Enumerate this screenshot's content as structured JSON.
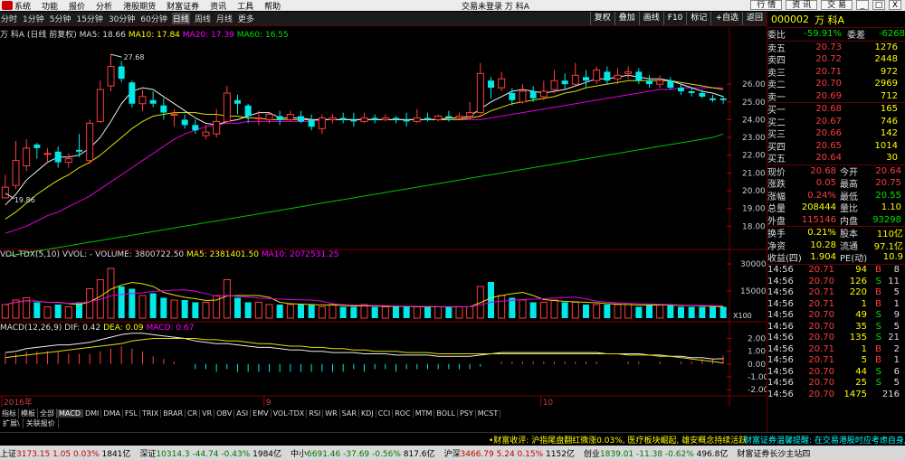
{
  "menu": {
    "items": [
      "系统",
      "功能",
      "报价",
      "分析",
      "港股期货",
      "财富证券",
      "资讯",
      "工具",
      "帮助"
    ],
    "title": "交易未登录  万 科A",
    "right_buttons": [
      "行 情",
      "资 讯",
      "交 易"
    ],
    "window_buttons": [
      "_",
      "□",
      "X"
    ]
  },
  "periods": {
    "items": [
      "分时",
      "1分钟",
      "5分钟",
      "15分钟",
      "30分钟",
      "60分钟",
      "日线",
      "周线",
      "月线",
      "更多"
    ],
    "active": "日线",
    "tools": [
      "复权",
      "叠加",
      "画线",
      "F10",
      "标记",
      "+自选",
      "返回"
    ]
  },
  "legend_main": {
    "name": "万 科A",
    "mode": "(日线 前复权)",
    "ma5_label": "MA5: 18.66",
    "ma10_label": "MA10: 17.84",
    "ma20_label": "MA20: 17.39",
    "ma60_label": "MA60: 16.55"
  },
  "legend_vol": {
    "name": "VOL-TDX(5,10)",
    "vvol": "VVOL: -",
    "volume": "VOLUME: 3800722.50",
    "ma5": "MA5: 2381401.50",
    "ma10": "MA10: 2072531.25"
  },
  "legend_macd": {
    "name": "MACD(12,26,9)",
    "dif": "DIF: 0.42",
    "dea": "DEA: 0.09",
    "macd": "MACD: 0.67"
  },
  "chart_data": {
    "type": "candlestick",
    "price_axis_ticks": [
      "26.00",
      "25.00",
      "24.00",
      "23.00",
      "22.00",
      "21.00",
      "20.00",
      "19.00",
      "18.00"
    ],
    "high_annotation": "27.68",
    "low_annotation": "19.86",
    "vol_axis_ticks": [
      "30000",
      "15000"
    ],
    "vol_unit": "X100",
    "macd_axis_ticks": [
      "2.00",
      "1.00",
      "0.00",
      "-1.00",
      "-2.00"
    ],
    "date_labels": [
      "2016年",
      "9",
      "10"
    ],
    "candles": [
      {
        "o": 19.6,
        "c": 20.2,
        "h": 20.9,
        "l": 19.86
      },
      {
        "o": 20.3,
        "c": 21.7,
        "h": 22.8,
        "l": 20.1
      },
      {
        "o": 21.4,
        "c": 22.4,
        "h": 22.9,
        "l": 21.1
      },
      {
        "o": 22.6,
        "c": 22.4,
        "h": 22.7,
        "l": 21.8
      },
      {
        "o": 22.1,
        "c": 22.1,
        "h": 22.4,
        "l": 21.6
      },
      {
        "o": 22.2,
        "c": 21.6,
        "h": 22.5,
        "l": 21.3
      },
      {
        "o": 21.6,
        "c": 21.8,
        "h": 22.1,
        "l": 21.3
      },
      {
        "o": 22.3,
        "c": 22.2,
        "h": 23.2,
        "l": 21.9
      },
      {
        "o": 21.7,
        "c": 23.8,
        "h": 24.0,
        "l": 21.5
      },
      {
        "o": 23.9,
        "c": 25.7,
        "h": 26.2,
        "l": 23.8
      },
      {
        "o": 25.9,
        "c": 27.0,
        "h": 27.68,
        "l": 25.6
      },
      {
        "o": 27.0,
        "c": 26.3,
        "h": 27.3,
        "l": 26.1
      },
      {
        "o": 26.1,
        "c": 24.9,
        "h": 26.2,
        "l": 24.7
      },
      {
        "o": 24.9,
        "c": 25.3,
        "h": 25.7,
        "l": 24.5
      },
      {
        "o": 25.1,
        "c": 24.9,
        "h": 25.6,
        "l": 24.7
      },
      {
        "o": 24.8,
        "c": 24.4,
        "h": 25.2,
        "l": 24.0
      },
      {
        "o": 24.3,
        "c": 24.3,
        "h": 24.6,
        "l": 23.6
      },
      {
        "o": 24.0,
        "c": 23.7,
        "h": 24.3,
        "l": 23.5
      },
      {
        "o": 23.7,
        "c": 23.4,
        "h": 24.0,
        "l": 23.2
      },
      {
        "o": 23.1,
        "c": 23.3,
        "h": 23.7,
        "l": 22.9
      },
      {
        "o": 23.2,
        "c": 23.9,
        "h": 24.6,
        "l": 23.0
      },
      {
        "o": 23.9,
        "c": 25.5,
        "h": 25.9,
        "l": 23.8
      },
      {
        "o": 25.1,
        "c": 24.9,
        "h": 25.4,
        "l": 24.3
      },
      {
        "o": 24.8,
        "c": 24.2,
        "h": 24.9,
        "l": 23.8
      },
      {
        "o": 24.1,
        "c": 24.1,
        "h": 24.5,
        "l": 23.7
      },
      {
        "o": 24.0,
        "c": 24.3,
        "h": 24.4,
        "l": 23.8
      },
      {
        "o": 24.2,
        "c": 24.0,
        "h": 24.5,
        "l": 23.7
      },
      {
        "o": 24.0,
        "c": 24.3,
        "h": 24.5,
        "l": 23.9
      },
      {
        "o": 24.2,
        "c": 23.9,
        "h": 24.5,
        "l": 23.8
      },
      {
        "o": 24.0,
        "c": 23.6,
        "h": 24.3,
        "l": 23.4
      },
      {
        "o": 23.5,
        "c": 24.1,
        "h": 24.3,
        "l": 23.2
      },
      {
        "o": 24.0,
        "c": 24.1,
        "h": 24.3,
        "l": 23.8
      },
      {
        "o": 24.1,
        "c": 24.0,
        "h": 24.4,
        "l": 23.8
      },
      {
        "o": 24.0,
        "c": 23.9,
        "h": 24.4,
        "l": 23.6
      },
      {
        "o": 23.9,
        "c": 24.1,
        "h": 24.4,
        "l": 23.8
      },
      {
        "o": 24.1,
        "c": 24.0,
        "h": 24.3,
        "l": 23.8
      },
      {
        "o": 24.0,
        "c": 24.1,
        "h": 24.3,
        "l": 23.9
      },
      {
        "o": 24.1,
        "c": 24.0,
        "h": 24.2,
        "l": 23.8
      },
      {
        "o": 24.0,
        "c": 23.9,
        "h": 24.4,
        "l": 23.6
      },
      {
        "o": 23.9,
        "c": 24.1,
        "h": 24.6,
        "l": 23.8
      },
      {
        "o": 24.1,
        "c": 24.0,
        "h": 24.4,
        "l": 23.9
      },
      {
        "o": 24.0,
        "c": 24.2,
        "h": 24.3,
        "l": 23.9
      },
      {
        "o": 24.2,
        "c": 24.1,
        "h": 24.5,
        "l": 23.9
      },
      {
        "o": 24.1,
        "c": 24.2,
        "h": 24.4,
        "l": 24.0
      },
      {
        "o": 24.2,
        "c": 24.4,
        "h": 25.0,
        "l": 24.0
      },
      {
        "o": 24.4,
        "c": 26.6,
        "h": 27.2,
        "l": 24.3
      },
      {
        "o": 26.2,
        "c": 25.8,
        "h": 26.4,
        "l": 25.2
      },
      {
        "o": 25.8,
        "c": 26.3,
        "h": 26.7,
        "l": 25.6
      },
      {
        "o": 25.5,
        "c": 25.1,
        "h": 25.8,
        "l": 24.8
      },
      {
        "o": 25.0,
        "c": 25.6,
        "h": 26.0,
        "l": 24.9
      },
      {
        "o": 25.6,
        "c": 25.2,
        "h": 25.9,
        "l": 25.0
      },
      {
        "o": 25.3,
        "c": 25.6,
        "h": 26.2,
        "l": 25.1
      },
      {
        "o": 25.7,
        "c": 26.2,
        "h": 26.8,
        "l": 25.5
      },
      {
        "o": 26.2,
        "c": 26.0,
        "h": 26.6,
        "l": 25.7
      },
      {
        "o": 26.0,
        "c": 26.5,
        "h": 27.2,
        "l": 25.9
      },
      {
        "o": 26.4,
        "c": 26.2,
        "h": 26.8,
        "l": 25.8
      },
      {
        "o": 26.2,
        "c": 26.8,
        "h": 27.0,
        "l": 26.0
      },
      {
        "o": 26.7,
        "c": 26.2,
        "h": 27.0,
        "l": 26.0
      },
      {
        "o": 26.3,
        "c": 26.5,
        "h": 26.9,
        "l": 26.0
      },
      {
        "o": 26.6,
        "c": 26.7,
        "h": 27.0,
        "l": 26.3
      },
      {
        "o": 26.7,
        "c": 26.2,
        "h": 26.9,
        "l": 26.0
      },
      {
        "o": 26.2,
        "c": 26.0,
        "h": 26.5,
        "l": 25.8
      },
      {
        "o": 26.0,
        "c": 26.2,
        "h": 26.5,
        "l": 25.8
      },
      {
        "o": 26.2,
        "c": 25.8,
        "h": 26.4,
        "l": 25.7
      },
      {
        "o": 25.8,
        "c": 25.6,
        "h": 26.0,
        "l": 25.4
      },
      {
        "o": 25.6,
        "c": 25.5,
        "h": 25.8,
        "l": 25.3
      },
      {
        "o": 25.5,
        "c": 25.3,
        "h": 25.7,
        "l": 25.2
      },
      {
        "o": 25.2,
        "c": 25.1,
        "h": 25.4,
        "l": 25.0
      },
      {
        "o": 25.2,
        "c": 25.1,
        "h": 25.3,
        "l": 24.9
      }
    ],
    "volumes": [
      6,
      8,
      9,
      7,
      5,
      6,
      5,
      7,
      13,
      17,
      22,
      14,
      13,
      10,
      11,
      9,
      8,
      8,
      7,
      7,
      10,
      17,
      9,
      7,
      7,
      6,
      6,
      6,
      6,
      6,
      5,
      6,
      5,
      5,
      6,
      5,
      5,
      5,
      5,
      5,
      5,
      5,
      5,
      5,
      5,
      14,
      16,
      10,
      9,
      8,
      7,
      7,
      8,
      7,
      7,
      6,
      6,
      6,
      6,
      6,
      5,
      6,
      6,
      6,
      5,
      5,
      5,
      5,
      5
    ],
    "ma5": [
      19.2,
      19.8,
      20.6,
      21.1,
      21.6,
      21.9,
      21.9,
      22.0,
      22.4,
      23.0,
      23.9,
      24.9,
      25.6,
      25.8,
      25.7,
      25.3,
      24.9,
      24.5,
      24.1,
      23.8,
      23.7,
      23.9,
      24.0,
      24.2,
      24.4,
      24.4,
      24.1,
      24.1,
      24.1,
      24.0,
      24.0,
      24.0,
      24.0,
      24.0,
      24.0,
      24.0,
      24.0,
      24.0,
      24.0,
      24.0,
      24.0,
      24.0,
      24.1,
      24.1,
      24.2,
      24.6,
      25.0,
      25.3,
      25.6,
      25.7,
      25.6,
      25.5,
      25.6,
      25.7,
      25.9,
      26.1,
      26.3,
      26.3,
      26.4,
      26.5,
      26.4,
      26.3,
      26.3,
      26.2,
      26.0,
      25.8,
      25.6,
      25.5,
      25.3
    ],
    "ma10": [
      18.4,
      18.8,
      19.3,
      19.8,
      20.2,
      20.6,
      20.9,
      21.3,
      21.6,
      22.0,
      22.5,
      23.0,
      23.5,
      23.9,
      24.2,
      24.3,
      24.4,
      24.4,
      24.4,
      24.3,
      24.3,
      24.2,
      24.2,
      24.1,
      24.1,
      24.0,
      24.0,
      24.0,
      24.0,
      24.0,
      24.0,
      24.0,
      24.0,
      24.0,
      24.0,
      24.0,
      24.0,
      24.0,
      24.0,
      24.0,
      24.0,
      24.0,
      24.0,
      24.0,
      24.1,
      24.2,
      24.5,
      24.7,
      24.9,
      25.0,
      25.1,
      25.2,
      25.3,
      25.5,
      25.6,
      25.8,
      25.9,
      26.0,
      26.1,
      26.2,
      26.2,
      26.2,
      26.2,
      26.2,
      26.1,
      26.0,
      25.9,
      25.8,
      25.7
    ],
    "ma20": [
      17.6,
      17.8,
      18.0,
      18.3,
      18.6,
      18.8,
      19.1,
      19.4,
      19.7,
      20.1,
      20.5,
      20.9,
      21.3,
      21.7,
      22.1,
      22.5,
      22.9,
      23.2,
      23.4,
      23.6,
      23.7,
      23.8,
      23.8,
      23.9,
      23.9,
      23.9,
      23.9,
      23.9,
      23.9,
      23.9,
      24.0,
      24.0,
      24.0,
      24.0,
      24.0,
      24.0,
      24.0,
      24.0,
      24.0,
      24.0,
      24.0,
      24.0,
      24.0,
      24.0,
      24.0,
      24.0,
      24.1,
      24.2,
      24.3,
      24.4,
      24.5,
      24.6,
      24.7,
      24.8,
      24.9,
      25.0,
      25.1,
      25.2,
      25.3,
      25.4,
      25.5,
      25.6,
      25.7,
      25.7,
      25.8,
      25.8,
      25.8,
      25.8,
      25.8
    ],
    "ma60": [
      16.3,
      16.4,
      16.5,
      16.6,
      16.7,
      16.8,
      16.9,
      17.0,
      17.1,
      17.2,
      17.3,
      17.4,
      17.5,
      17.6,
      17.7,
      17.8,
      17.9,
      18.0,
      18.1,
      18.2,
      18.3,
      18.4,
      18.5,
      18.6,
      18.7,
      18.8,
      18.9,
      19.0,
      19.1,
      19.2,
      19.3,
      19.4,
      19.5,
      19.6,
      19.7,
      19.8,
      19.9,
      20.0,
      20.1,
      20.2,
      20.3,
      20.4,
      20.5,
      20.6,
      20.7,
      20.8,
      20.9,
      21.0,
      21.1,
      21.2,
      21.3,
      21.4,
      21.5,
      21.6,
      21.7,
      21.8,
      21.9,
      22.0,
      22.1,
      22.2,
      22.3,
      22.4,
      22.5,
      22.6,
      22.7,
      22.8,
      22.9,
      23.0,
      23.2
    ],
    "dif": [
      0.9,
      1.0,
      1.2,
      1.3,
      1.4,
      1.5,
      1.5,
      1.6,
      1.7,
      1.9,
      2.1,
      2.3,
      2.4,
      2.4,
      2.3,
      2.2,
      2.1,
      2.0,
      1.8,
      1.7,
      1.6,
      1.6,
      1.5,
      1.4,
      1.3,
      1.3,
      1.2,
      1.1,
      1.1,
      1.0,
      1.0,
      0.9,
      0.9,
      0.9,
      0.8,
      0.8,
      0.8,
      0.7,
      0.7,
      0.7,
      0.7,
      0.6,
      0.6,
      0.6,
      0.6,
      0.7,
      0.8,
      0.9,
      0.9,
      0.9,
      0.9,
      0.9,
      0.9,
      0.9,
      0.9,
      0.9,
      0.9,
      0.8,
      0.8,
      0.8,
      0.8,
      0.7,
      0.7,
      0.6,
      0.6,
      0.5,
      0.5,
      0.4,
      0.42
    ],
    "dea": [
      0.5,
      0.6,
      0.7,
      0.8,
      0.9,
      1.0,
      1.1,
      1.2,
      1.3,
      1.4,
      1.5,
      1.6,
      1.8,
      1.9,
      2.0,
      2.0,
      2.0,
      2.0,
      2.0,
      1.9,
      1.9,
      1.8,
      1.8,
      1.7,
      1.6,
      1.6,
      1.5,
      1.4,
      1.4,
      1.3,
      1.3,
      1.2,
      1.2,
      1.1,
      1.1,
      1.0,
      1.0,
      1.0,
      0.9,
      0.9,
      0.9,
      0.8,
      0.8,
      0.8,
      0.8,
      0.8,
      0.8,
      0.8,
      0.8,
      0.8,
      0.8,
      0.8,
      0.8,
      0.8,
      0.8,
      0.8,
      0.8,
      0.8,
      0.8,
      0.7,
      0.7,
      0.7,
      0.6,
      0.6,
      0.5,
      0.4,
      0.3,
      0.2,
      0.09
    ]
  },
  "indicator_tabs": [
    "指标",
    "模板",
    "全部",
    "MACD",
    "DMI",
    "DMA",
    "FSL",
    "TRIX",
    "BRAR",
    "CR",
    "VR",
    "OBV",
    "ASI",
    "EMV",
    "VOL-TDX",
    "RSI",
    "WR",
    "SAR",
    "KDJ",
    "CCI",
    "ROC",
    "MTM",
    "BOLL",
    "PSY",
    "MCST"
  ],
  "sub_tabs": [
    "扩展\\",
    "关联报价"
  ],
  "quote": {
    "code": "000002",
    "name": "万 科A",
    "weibi_label": "委比",
    "weibi_value": "-59.91%",
    "weicha_label": "委差",
    "weicha_value": "-6268",
    "asks": [
      {
        "label": "卖五",
        "price": "20.73",
        "vol": "1276"
      },
      {
        "label": "卖四",
        "price": "20.72",
        "vol": "2448"
      },
      {
        "label": "卖三",
        "price": "20.71",
        "vol": "972"
      },
      {
        "label": "卖二",
        "price": "20.70",
        "vol": "2969"
      },
      {
        "label": "卖一",
        "price": "20.69",
        "vol": "712"
      }
    ],
    "bids": [
      {
        "label": "买一",
        "price": "20.68",
        "vol": "165"
      },
      {
        "label": "买二",
        "price": "20.67",
        "vol": "746"
      },
      {
        "label": "买三",
        "price": "20.66",
        "vol": "142"
      },
      {
        "label": "买四",
        "price": "20.65",
        "vol": "1014"
      },
      {
        "label": "买五",
        "price": "20.64",
        "vol": "30"
      }
    ],
    "stats": [
      {
        "k1": "现价",
        "v1": "20.68",
        "k2": "今开",
        "v2": "20.64",
        "c1": "up",
        "c2": "up"
      },
      {
        "k1": "涨跌",
        "v1": "0.05",
        "k2": "最高",
        "v2": "20.75",
        "c1": "up",
        "c2": "up"
      },
      {
        "k1": "涨幅",
        "v1": "0.24%",
        "k2": "最低",
        "v2": "20.55",
        "c1": "up",
        "c2": "dn"
      },
      {
        "k1": "总量",
        "v1": "208444",
        "k2": "量比",
        "v2": "1.10",
        "c1": "yl",
        "c2": "yl"
      },
      {
        "k1": "外盘",
        "v1": "115146",
        "k2": "内盘",
        "v2": "93298",
        "c1": "up",
        "c2": "dn"
      }
    ],
    "stats2": [
      {
        "k1": "换手",
        "v1": "0.21%",
        "k2": "股本",
        "v2": "110亿"
      },
      {
        "k1": "净资",
        "v1": "10.28",
        "k2": "流通",
        "v2": "97.1亿"
      },
      {
        "k1": "收益(四)",
        "v1": "1.904",
        "k2": "PE(动)",
        "v2": "10.9"
      }
    ],
    "ticks": [
      {
        "t": "14:56",
        "p": "20.71",
        "v": "94",
        "d": "B",
        "n": "8"
      },
      {
        "t": "14:56",
        "p": "20.70",
        "v": "126",
        "d": "S",
        "n": "11"
      },
      {
        "t": "14:56",
        "p": "20.71",
        "v": "220",
        "d": "B",
        "n": "5"
      },
      {
        "t": "14:56",
        "p": "20.71",
        "v": "1",
        "d": "B",
        "n": "1"
      },
      {
        "t": "14:56",
        "p": "20.70",
        "v": "49",
        "d": "S",
        "n": "9"
      },
      {
        "t": "14:56",
        "p": "20.70",
        "v": "35",
        "d": "S",
        "n": "5"
      },
      {
        "t": "14:56",
        "p": "20.70",
        "v": "135",
        "d": "S",
        "n": "21"
      },
      {
        "t": "14:56",
        "p": "20.71",
        "v": "1",
        "d": "B",
        "n": "2"
      },
      {
        "t": "14:56",
        "p": "20.71",
        "v": "5",
        "d": "B",
        "n": "1"
      },
      {
        "t": "14:56",
        "p": "20.70",
        "v": "44",
        "d": "S",
        "n": "6"
      },
      {
        "t": "14:56",
        "p": "20.70",
        "v": "25",
        "d": "S",
        "n": "5"
      },
      {
        "t": "14:56",
        "p": "20.70",
        "v": "1475",
        "d": "",
        "n": "216"
      }
    ]
  },
  "ticker": {
    "text": "•财富收评: 沪指尾盘翻红微涨0.03%, 医疗板块崛起, 雄安概念持续活跃",
    "text2": "财富证券温馨提醒: 在交易港股时应考虑自身风险"
  },
  "status": [
    {
      "label": "上证",
      "price": "3173.15",
      "chg": "1.05",
      "pct": "0.03%",
      "amt": "1841亿",
      "dir": "up"
    },
    {
      "label": "深证",
      "price": "10314.3",
      "chg": "-44.74",
      "pct": "-0.43%",
      "amt": "1984亿",
      "dir": "dn"
    },
    {
      "label": "中小",
      "price": "6691.46",
      "chg": "-37.69",
      "pct": "-0.56%",
      "amt": "817.6亿",
      "dir": "dn"
    },
    {
      "label": "沪深",
      "price": "3466.79",
      "chg": "5.24",
      "pct": "0.15%",
      "amt": "1152亿",
      "dir": "up"
    },
    {
      "label": "创业",
      "price": "1839.01",
      "chg": "-11.38",
      "pct": "-0.62%",
      "amt": "496.8亿",
      "dir": "dn"
    }
  ],
  "status_right": "财富证券长沙主站四"
}
